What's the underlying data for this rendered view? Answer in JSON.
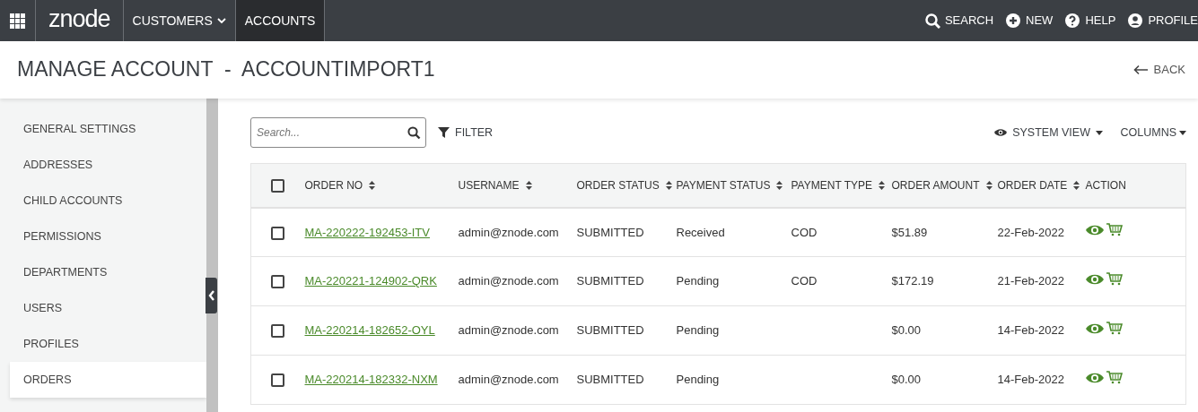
{
  "navbar": {
    "logo": "znode",
    "menu": [
      {
        "label": "CUSTOMERS",
        "dropdown": true,
        "selected": false
      },
      {
        "label": "ACCOUNTS",
        "dropdown": false,
        "selected": true
      }
    ],
    "actions": [
      {
        "kind": "search",
        "label": "SEARCH"
      },
      {
        "kind": "new",
        "label": "NEW"
      },
      {
        "kind": "help",
        "label": "HELP"
      },
      {
        "kind": "profile",
        "label": "PROFILE"
      }
    ]
  },
  "page": {
    "title": "MANAGE ACCOUNT  -  ACCOUNTIMPORT1",
    "back": "BACK"
  },
  "sidebar": {
    "items": [
      {
        "label": "GENERAL SETTINGS",
        "selected": false
      },
      {
        "label": "ADDRESSES",
        "selected": false
      },
      {
        "label": "CHILD ACCOUNTS",
        "selected": false
      },
      {
        "label": "PERMISSIONS",
        "selected": false
      },
      {
        "label": "DEPARTMENTS",
        "selected": false
      },
      {
        "label": "USERS",
        "selected": false
      },
      {
        "label": "PROFILES",
        "selected": false
      },
      {
        "label": "ORDERS",
        "selected": true
      }
    ]
  },
  "toolbar": {
    "search": {
      "placeholder": "Search..."
    },
    "filter": "FILTER",
    "view": "SYSTEM VIEW",
    "columns": "COLUMNS"
  },
  "table": {
    "select_all": {
      "checked": false
    },
    "columns": [
      {
        "label": "ORDER NO",
        "sortable": true
      },
      {
        "label": "USERNAME",
        "sortable": true
      },
      {
        "label": "ORDER STATUS",
        "sortable": true
      },
      {
        "label": "PAYMENT STATUS",
        "sortable": true
      },
      {
        "label": "PAYMENT TYPE",
        "sortable": true
      },
      {
        "label": "ORDER AMOUNT",
        "sortable": true
      },
      {
        "label": "ORDER DATE",
        "sortable": true
      },
      {
        "label": "ACTION",
        "sortable": false
      }
    ],
    "rows": [
      {
        "checked": false,
        "cells": [
          "MA-220222-192453-ITV",
          "admin@znode.com",
          "SUBMITTED",
          "Received",
          "COD",
          "$51.89",
          "22-Feb-2022"
        ]
      },
      {
        "checked": false,
        "cells": [
          "MA-220221-124902-QRK",
          "admin@znode.com",
          "SUBMITTED",
          "Pending",
          "COD",
          "$172.19",
          "21-Feb-2022"
        ]
      },
      {
        "checked": false,
        "cells": [
          "MA-220214-182652-OYL",
          "admin@znode.com",
          "SUBMITTED",
          "Pending",
          null,
          "$0.00",
          "14-Feb-2022"
        ]
      },
      {
        "checked": false,
        "cells": [
          "MA-220214-182332-NXM",
          "admin@znode.com",
          "SUBMITTED",
          "Pending",
          null,
          "$0.00",
          "14-Feb-2022"
        ]
      }
    ]
  }
}
